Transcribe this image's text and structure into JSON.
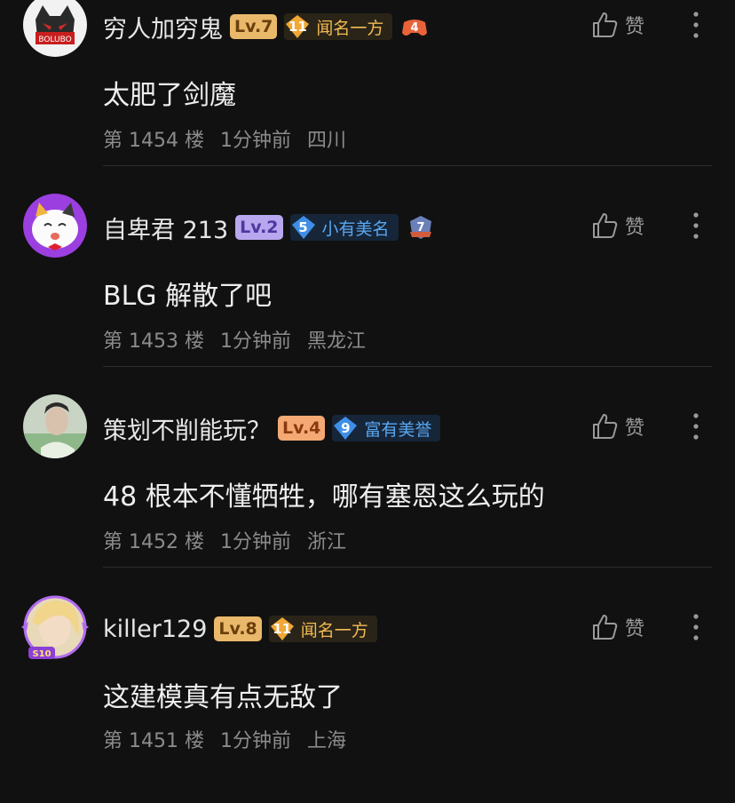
{
  "comments": [
    {
      "username": "穷人加穷鬼",
      "level": "Lv.7",
      "fame_number": "11",
      "fame_title": "闻名一方",
      "badge_number": "4",
      "content": "太肥了剑魔",
      "floor": "第 1454 楼",
      "time": "1分钟前",
      "location": "四川",
      "like_label": "赞"
    },
    {
      "username": "自卑君 213",
      "level": "Lv.2",
      "fame_number": "5",
      "fame_title": "小有美名",
      "badge_number": "7",
      "content": "BLG 解散了吧",
      "floor": "第 1453 楼",
      "time": "1分钟前",
      "location": "黑龙江",
      "like_label": "赞"
    },
    {
      "username": "策划不削能玩？",
      "level": "Lv.4",
      "fame_number": "9",
      "fame_title": "富有美誉",
      "content": "48 根本不懂牺牲，哪有塞恩这么玩的",
      "floor": "第 1452 楼",
      "time": "1分钟前",
      "location": "浙江",
      "like_label": "赞"
    },
    {
      "username": "killer129",
      "level": "Lv.8",
      "fame_number": "11",
      "fame_title": "闻名一方",
      "avatar_frame_text": "S10",
      "content": "这建模真有点无敌了",
      "floor": "第 1451 楼",
      "time": "1分钟前",
      "location": "上海",
      "like_label": "赞"
    }
  ],
  "colors": {
    "background": "#111111",
    "fame_gold": "#f2bb53",
    "fame_blue": "#5aa8f2",
    "meta_gray": "#8b8b8b"
  }
}
